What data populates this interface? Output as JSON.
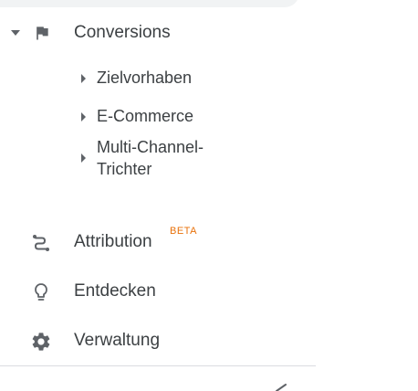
{
  "conversions": {
    "label": "Conversions",
    "expanded": true,
    "icon": "flag-icon",
    "children": [
      {
        "label": "Zielvorhaben"
      },
      {
        "label": "E-Commerce"
      },
      {
        "label_line1": "Multi-Channel-",
        "label_line2": "Trichter"
      }
    ]
  },
  "nav": {
    "attribution": {
      "label": "Attribution",
      "badge": "BETA",
      "icon": "attribution-icon"
    },
    "discover": {
      "label": "Entdecken",
      "icon": "lightbulb-icon"
    },
    "admin": {
      "label": "Verwaltung",
      "icon": "gear-icon"
    }
  },
  "colors": {
    "text": "#3c4043",
    "icon": "#5f6368",
    "badge": "#e8710a",
    "divider": "#dadce0"
  }
}
